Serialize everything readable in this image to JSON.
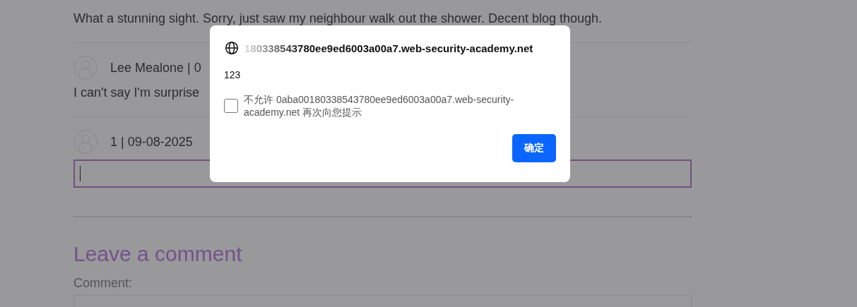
{
  "comments": [
    {
      "kind": "text",
      "body": "What a stunning sight. Sorry, just saw my neighbour walk out the shower. Decent blog though."
    },
    {
      "kind": "text",
      "author": "Lee Mealone | 0",
      "body": "I can't say I'm surprise"
    },
    {
      "kind": "editor",
      "author": "1 | 09-08-2025"
    }
  ],
  "leave_comment": {
    "heading": "Leave a comment",
    "comment_label": "Comment:"
  },
  "dialog": {
    "origin": "180338543780ee9ed6003a00a7.web-security-academy.net",
    "message": "123",
    "suppress": {
      "label": "不允许 0aba00180338543780ee9ed6003a00a7.web-security-academy.net 再次向您提示",
      "checked": false
    },
    "ok_button": "确定"
  }
}
